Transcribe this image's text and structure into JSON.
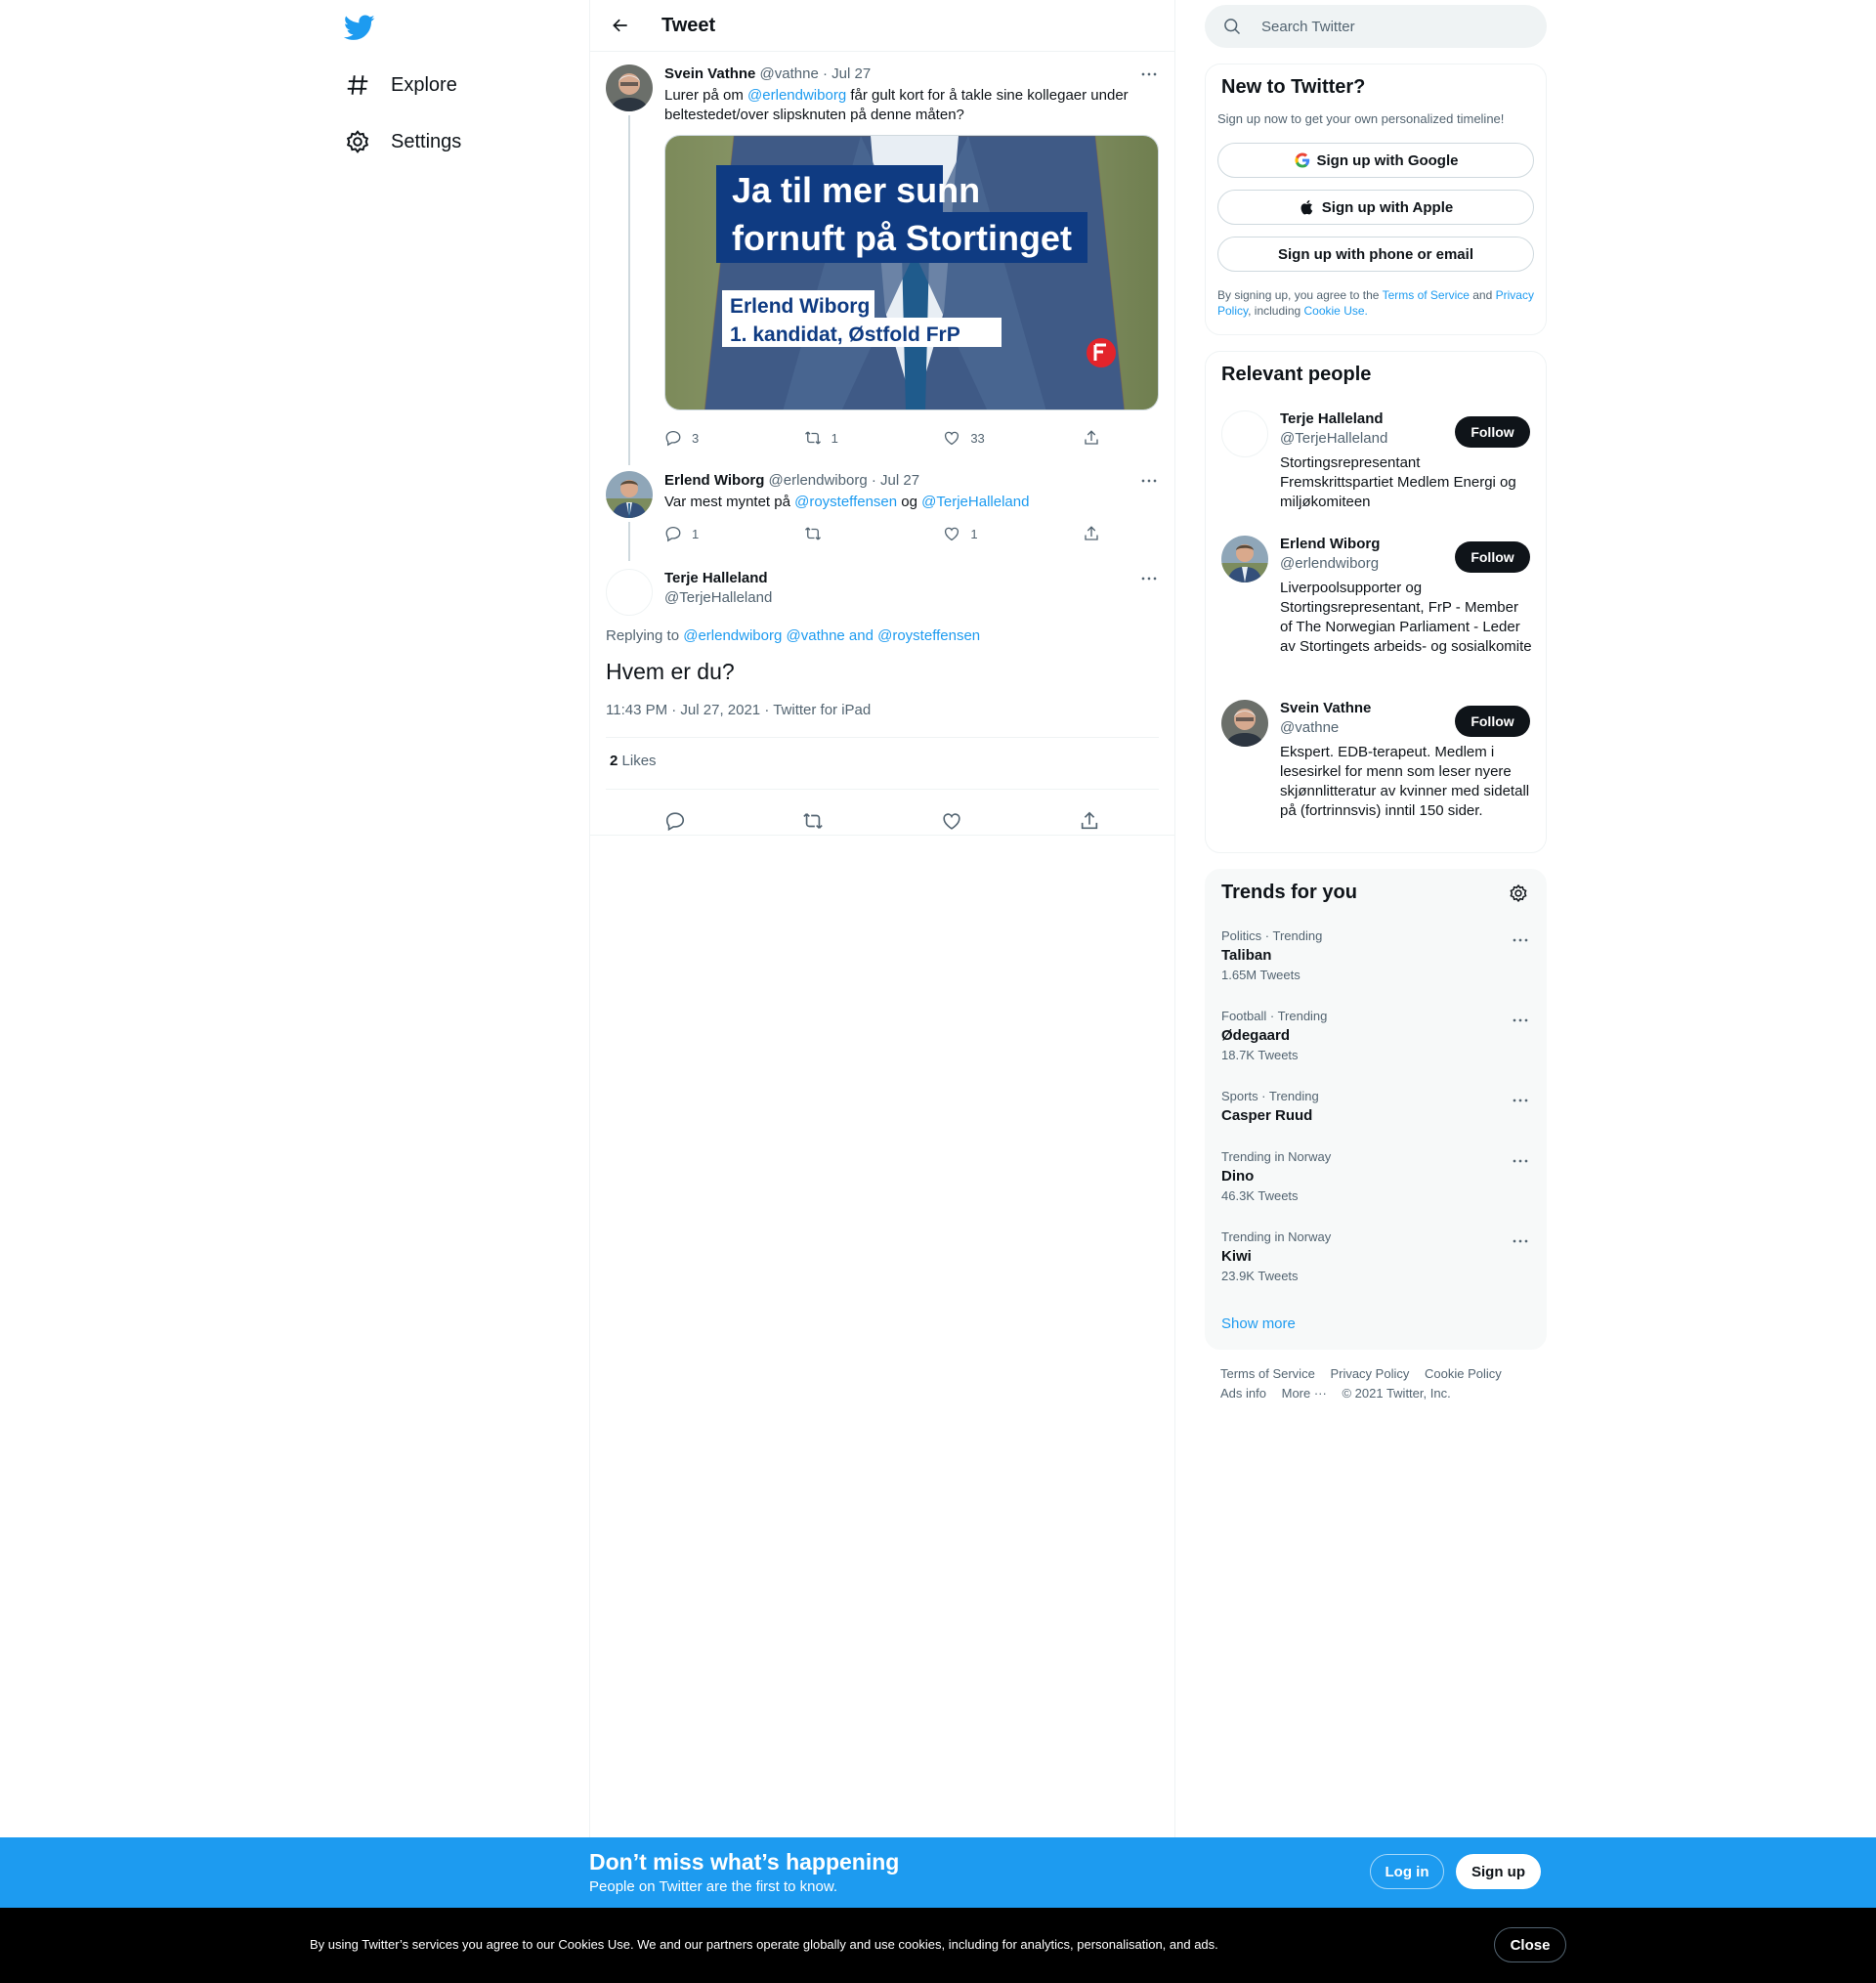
{
  "nav": {
    "explore_label": "Explore",
    "settings_label": "Settings"
  },
  "header": {
    "title": "Tweet"
  },
  "tweets": [
    {
      "name": "Svein Vathne",
      "handle": "@vathne",
      "date": "Jul 27",
      "text_before": "Lurer på om ",
      "mention": "@erlendwiborg",
      "text_after": " får gult kort for å takle sine kollegaer under beltestedet/over slipsknuten på denne måten?",
      "media_line1": "Ja til mer sunn",
      "media_line2": "fornuft på Stortinget",
      "media_line3": "Erlend Wiborg",
      "media_line4": "1. kandidat, Østfold FrP",
      "replies": "3",
      "retweets": "1",
      "likes": "33"
    },
    {
      "name": "Erlend Wiborg",
      "handle": "@erlendwiborg",
      "date": "Jul 27",
      "text_before": "Var mest myntet på ",
      "mention1": "@roysteffensen",
      "text_mid": " og ",
      "mention2": "@TerjeHalleland",
      "replies": "1",
      "retweets": "",
      "likes": "1"
    }
  ],
  "focal": {
    "name": "Terje Halleland",
    "handle": "@TerjeHalleland",
    "replying_prefix": "Replying to ",
    "replying_to": "@erlendwiborg @vathne and @roysteffensen",
    "text": "Hvem er du?",
    "meta": "11:43 PM · Jul 27, 2021 · Twitter for iPad",
    "likes_count": "2",
    "likes_label": "Likes"
  },
  "search": {
    "placeholder": "Search Twitter"
  },
  "signup": {
    "title": "New to Twitter?",
    "subtitle": "Sign up now to get your own personalized timeline!",
    "google": "Sign up with Google",
    "apple": "Sign up with Apple",
    "phone": "Sign up with phone or email",
    "legal_1": "By signing up, you agree to the ",
    "terms": "Terms of Service",
    "legal_2": " and ",
    "privacy": "Privacy Policy",
    "legal_3": ", including ",
    "cookie": "Cookie Use."
  },
  "relevant": {
    "title": "Relevant people",
    "follow_label": "Follow",
    "people": [
      {
        "name": "Terje Halleland",
        "handle": "@TerjeHalleland",
        "bio": "Stortingsrepresentant Fremskrittspartiet Medlem Energi og miljøkomiteen"
      },
      {
        "name": "Erlend Wiborg",
        "handle": "@erlendwiborg",
        "bio": "Liverpoolsupporter og Stortingsrepresentant, FrP - Member of The Norwegian Parliament - Leder av Stortingets arbeids- og sosialkomite"
      },
      {
        "name": "Svein Vathne",
        "handle": "@vathne",
        "bio": "Ekspert. EDB-terapeut. Medlem i lesesirkel for menn som leser nyere skjønnlitteratur av kvinner med sidetall på (fortrinnsvis) inntil 150 sider."
      }
    ]
  },
  "trends": {
    "title": "Trends for you",
    "items": [
      {
        "context": "Politics · Trending",
        "name": "Taliban",
        "count": "1.65M Tweets"
      },
      {
        "context": "Football · Trending",
        "name": "Ødegaard",
        "count": "18.7K Tweets"
      },
      {
        "context": "Sports · Trending",
        "name": "Casper Ruud",
        "count": ""
      },
      {
        "context": "Trending in Norway",
        "name": "Dino",
        "count": "46.3K Tweets"
      },
      {
        "context": "Trending in Norway",
        "name": "Kiwi",
        "count": "23.9K Tweets"
      }
    ],
    "show_more": "Show more"
  },
  "footer": {
    "terms": "Terms of Service",
    "privacy": "Privacy Policy",
    "cookie": "Cookie Policy",
    "ads": "Ads info",
    "more": "More ···",
    "copyright": "© 2021 Twitter, Inc."
  },
  "banner": {
    "title": "Don’t miss what’s happening",
    "subtitle": "People on Twitter are the first to know.",
    "login": "Log in",
    "signup": "Sign up"
  },
  "cookies": {
    "text": "By using Twitter’s services you agree to our Cookies Use. We and our partners operate globally and use cookies, including for analytics, personalisation, and ads.",
    "close": "Close"
  },
  "colors": {
    "accent": "#1d9bf0",
    "text": "#0f1419",
    "muted": "#536471",
    "frp_blue": "#0f3b82"
  }
}
